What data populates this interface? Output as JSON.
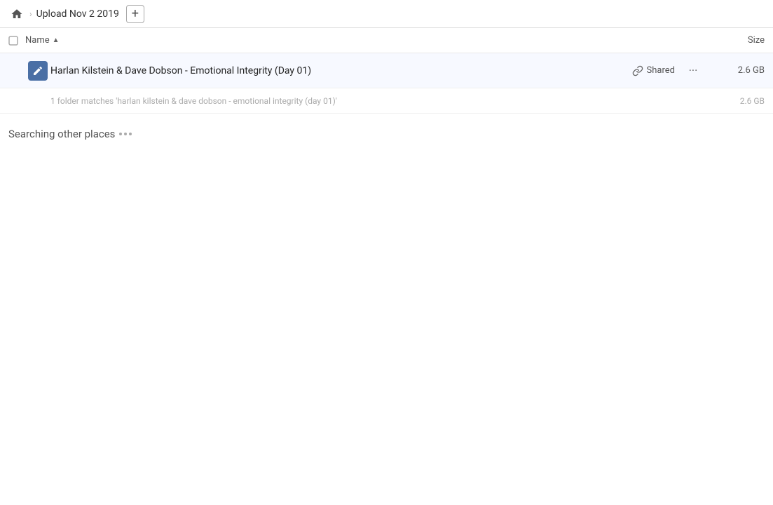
{
  "header": {
    "home_icon": "home",
    "breadcrumb_title": "Upload Nov 2 2019",
    "add_button_label": "+"
  },
  "columns": {
    "name_label": "Name",
    "sort_direction": "▲",
    "size_label": "Size"
  },
  "file_row": {
    "name": "Harlan Kilstein & Dave Dobson - Emotional Integrity (Day 01)",
    "shared_label": "Shared",
    "size": "2.6 GB",
    "more_dots": "···"
  },
  "sub_row": {
    "text": "1 folder matches 'harlan kilstein & dave dobson - emotional integrity (day 01)'",
    "size": "2.6 GB"
  },
  "searching_section": {
    "label": "Searching other places"
  }
}
